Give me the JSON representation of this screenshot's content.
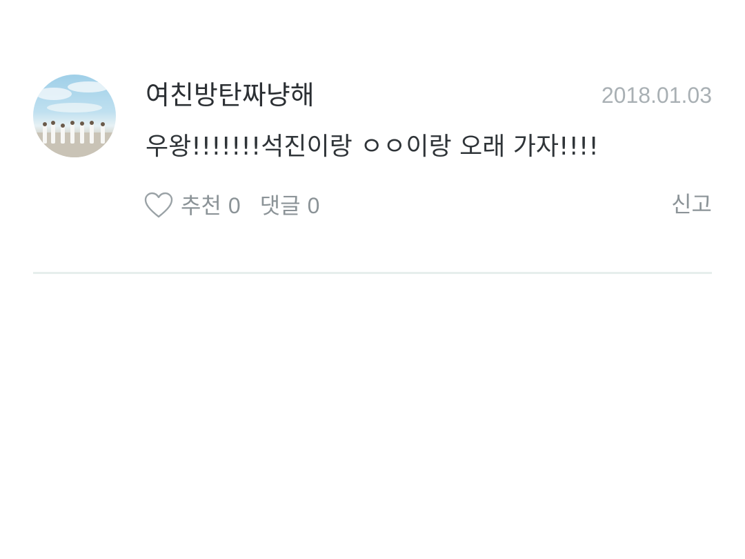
{
  "comment": {
    "username": "여친방탄짜냥해",
    "date": "2018.01.03",
    "text": "우왕!!!!!!!석진이랑 ㅇㅇ이랑 오래 가자!!!!",
    "actions": {
      "like_label": "추천",
      "like_count": "0",
      "reply_label": "댓글",
      "reply_count": "0",
      "report_label": "신고"
    },
    "icons": {
      "like": "heart-outline-icon"
    }
  },
  "colors": {
    "username": "#2b2f33",
    "date": "#a9b0b4",
    "action": "#8b9397",
    "divider": "#e6eeec"
  }
}
